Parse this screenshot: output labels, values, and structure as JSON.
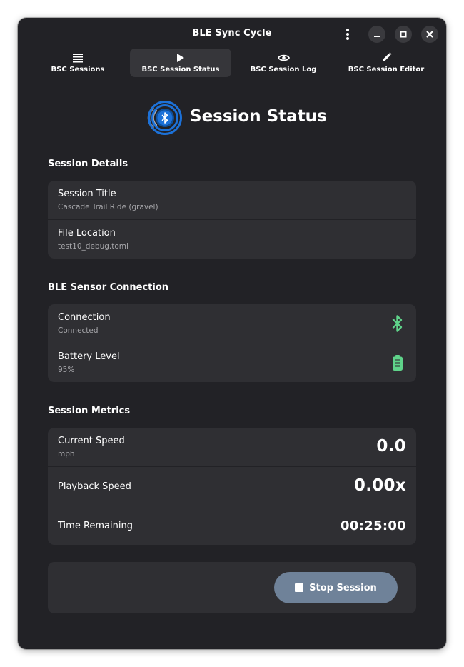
{
  "window": {
    "title": "BLE Sync Cycle"
  },
  "tabs": [
    {
      "label": "BSC Sessions",
      "icon": "list-icon",
      "active": false
    },
    {
      "label": "BSC Session Status",
      "icon": "play-icon",
      "active": true
    },
    {
      "label": "BSC Session Log",
      "icon": "eye-icon",
      "active": false
    },
    {
      "label": "BSC Session Editor",
      "icon": "pencil-icon",
      "active": false
    }
  ],
  "header": {
    "title": "Session Status",
    "logo_icon": "bluetooth-signal-icon"
  },
  "session_details": {
    "heading": "Session Details",
    "rows": [
      {
        "title": "Session Title",
        "subtitle": "Cascade Trail Ride (gravel)"
      },
      {
        "title": "File Location",
        "subtitle": "test10_debug.toml"
      }
    ]
  },
  "ble_connection": {
    "heading": "BLE Sensor Connection",
    "rows": [
      {
        "title": "Connection",
        "subtitle": "Connected",
        "icon": "bluetooth-icon"
      },
      {
        "title": "Battery Level",
        "subtitle": "95%",
        "icon": "battery-icon"
      }
    ]
  },
  "session_metrics": {
    "heading": "Session Metrics",
    "rows": [
      {
        "title": "Current Speed",
        "subtitle": "mph",
        "value": "0.0"
      },
      {
        "title": "Playback Speed",
        "value": "0.00x"
      },
      {
        "title": "Time Remaining",
        "value": "00:25:00"
      }
    ]
  },
  "actions": {
    "stop_label": "Stop Session"
  },
  "colors": {
    "window_bg": "#222226",
    "card_bg": "#2f2f33",
    "status_green": "#5fd38a",
    "button_bg": "#6f8299",
    "logo_blue": "#1c71d8"
  }
}
